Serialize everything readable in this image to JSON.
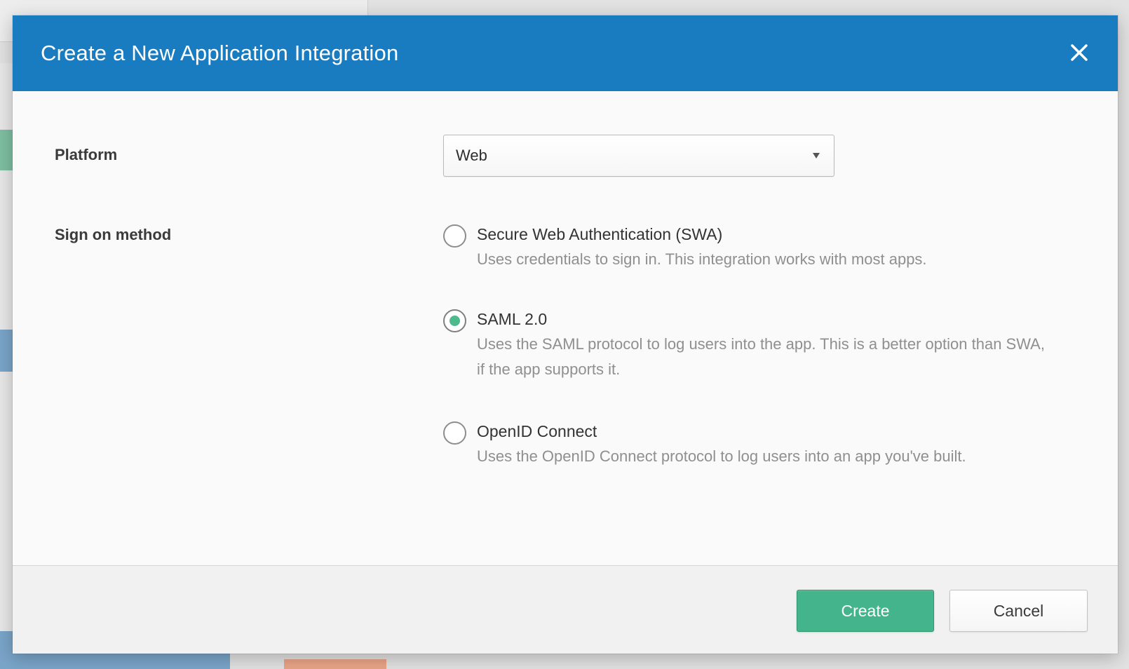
{
  "dialog": {
    "title": "Create a New Application Integration",
    "close_icon": "close-icon"
  },
  "platform": {
    "label": "Platform",
    "selected": "Web",
    "dropdown_icon": "caret-down-icon"
  },
  "sign_on": {
    "label": "Sign on method",
    "options": [
      {
        "label": "Secure Web Authentication (SWA)",
        "description": "Uses credentials to sign in. This integration works with most apps.",
        "selected": false
      },
      {
        "label": "SAML 2.0",
        "description": "Uses the SAML protocol to log users into the app. This is a better option than SWA, if the app supports it.",
        "selected": true
      },
      {
        "label": "OpenID Connect",
        "description": "Uses the OpenID Connect protocol to log users into an app you've built.",
        "selected": false
      }
    ]
  },
  "footer": {
    "create_label": "Create",
    "cancel_label": "Cancel"
  },
  "colors": {
    "header": "#1a7cc0",
    "primary_button": "#43b48c",
    "radio_selected": "#4cb98f"
  }
}
